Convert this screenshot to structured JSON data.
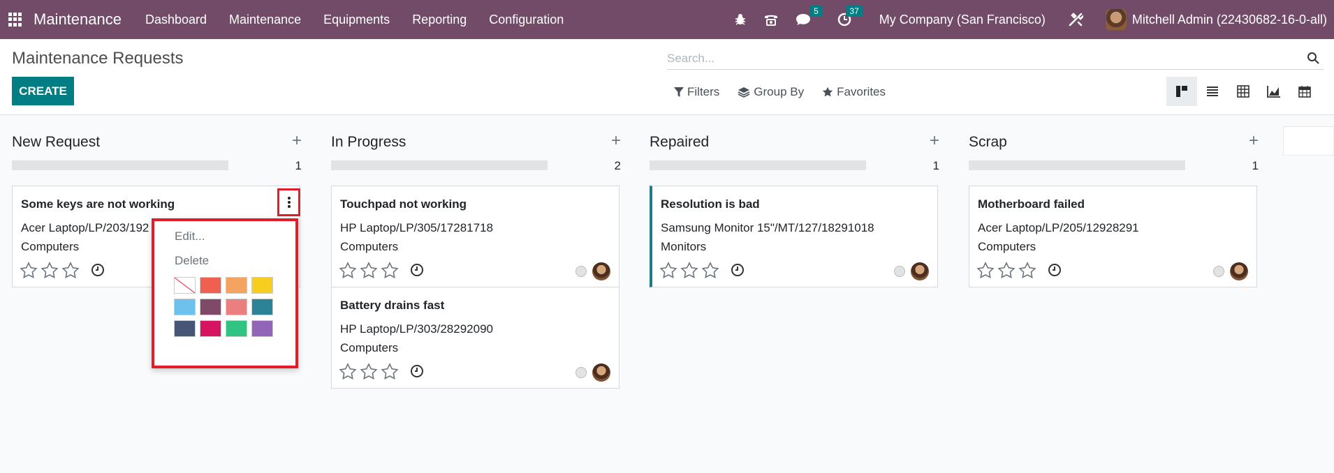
{
  "navbar": {
    "app_name": "Maintenance",
    "menu": [
      "Dashboard",
      "Maintenance",
      "Equipments",
      "Reporting",
      "Configuration"
    ],
    "messages_count": "5",
    "activities_count": "37",
    "company": "My Company (San Francisco)",
    "user": "Mitchell Admin (22430682-16-0-all)"
  },
  "control": {
    "title": "Maintenance Requests",
    "create_label": "CREATE",
    "search_placeholder": "Search...",
    "filters_label": "Filters",
    "groupby_label": "Group By",
    "favorites_label": "Favorites"
  },
  "columns": [
    {
      "title": "New Request",
      "count": "1",
      "cards": [
        {
          "title": "Some keys are not working",
          "equipment": "Acer Laptop/LP/203/192",
          "category": "Computers"
        }
      ]
    },
    {
      "title": "In Progress",
      "count": "2",
      "cards": [
        {
          "title": "Touchpad not working",
          "equipment": "HP Laptop/LP/305/17281718",
          "category": "Computers"
        },
        {
          "title": "Battery drains fast",
          "equipment": "HP Laptop/LP/303/28292090",
          "category": "Computers"
        }
      ]
    },
    {
      "title": "Repaired",
      "count": "1",
      "cards": [
        {
          "title": "Resolution is bad",
          "equipment": "Samsung Monitor 15\"/MT/127/18291018",
          "category": "Monitors"
        }
      ]
    },
    {
      "title": "Scrap",
      "count": "1",
      "cards": [
        {
          "title": "Motherboard failed",
          "equipment": "Acer Laptop/LP/205/12928291",
          "category": "Computers"
        }
      ]
    }
  ],
  "dropdown": {
    "edit_label": "Edit...",
    "delete_label": "Delete",
    "colors": [
      "#ffffff",
      "#f06050",
      "#f4a460",
      "#f7cd1f",
      "#6cc1ed",
      "#814968",
      "#eb7e7f",
      "#2c8397",
      "#475577",
      "#d6145f",
      "#30c381",
      "#9365b8"
    ]
  },
  "accent_colors": {
    "navbar": "#714b67",
    "primary": "#017e84",
    "highlight": "#e31c2a"
  }
}
